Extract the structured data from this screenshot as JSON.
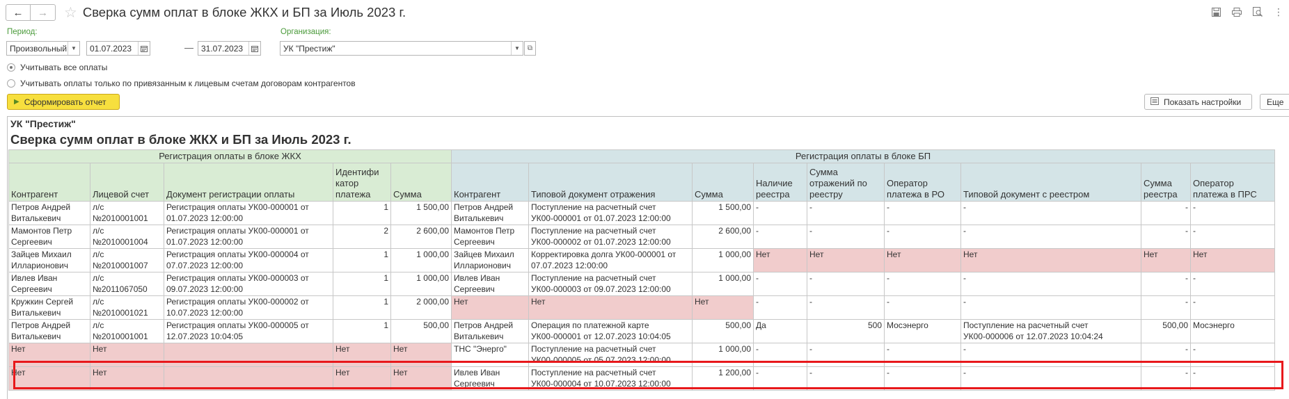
{
  "window": {
    "title": "Сверка сумм оплат в блоке ЖКХ и БП за Июль 2023 г.",
    "nav": {
      "back_icon": "arrow-left-icon",
      "forward_icon": "arrow-right-icon"
    },
    "toolbar_icons": [
      "save-icon",
      "print-icon",
      "preview-icon",
      "more-vertical-icon"
    ]
  },
  "form": {
    "period_label": "Период:",
    "period_type": "Произвольный",
    "date_from": "01.07.2023",
    "date_to": "31.07.2023",
    "period_separator": "—",
    "org_label": "Организация:",
    "org_value": "УК \"Престиж\"",
    "radio_all": "Учитывать все оплаты",
    "radio_linked": "Учитывать оплаты только по привязанным к лицевым счетам договорам контрагентов",
    "radio_selected": "all",
    "run_button": "Сформировать отчет",
    "settings_button": "Показать настройки",
    "more_button": "Еще"
  },
  "report": {
    "org": "УК \"Престиж\"",
    "title": "Сверка сумм оплат в блоке ЖКХ и БП за Июль 2023 г.",
    "group1": "Регистрация оплаты в блоке ЖКХ",
    "group2": "Регистрация оплаты в блоке БП",
    "colors": {
      "jkh_header": "#d9ecd4",
      "bp_header": "#d4e4e7",
      "mismatch": "#f1cccc",
      "highlight": "#e8181b"
    },
    "columns": [
      "Контрагент",
      "Лицевой счет",
      "Документ регистрации оплаты",
      "Идентифи\nкатор\nплатежа",
      "Сумма",
      "Контрагент",
      "Типовой документ отражения",
      "Сумма",
      "Наличие\nреестра",
      "Сумма\nотражений по\nреестру",
      "Оператор\nплатежа в РО",
      "Типовой документ с реестром",
      "Сумма\nреестра",
      "Оператор\nплатежа в ПРС"
    ],
    "rows": [
      {
        "cells": [
          "Петров Андрей\nВиталькевич",
          "л/с\n№2010001001",
          "Регистрация оплаты УК00-000001 от\n01.07.2023 12:00:00",
          "1",
          "1 500,00",
          "Петров Андрей\nВиталькевич",
          "Поступление на расчетный счет\nУК00-000001 от 01.07.2023 12:00:00",
          "1 500,00",
          "-",
          "-",
          "-",
          "-",
          "-",
          "-"
        ],
        "bad": []
      },
      {
        "cells": [
          "Мамонтов Петр\nСергеевич",
          "л/с\n№2010001004",
          "Регистрация оплаты УК00-000001 от\n01.07.2023 12:00:00",
          "2",
          "2 600,00",
          "Мамонтов Петр\nСергеевич",
          "Поступление на расчетный счет\nУК00-000002 от 01.07.2023 12:00:00",
          "2 600,00",
          "-",
          "-",
          "-",
          "-",
          "-",
          "-"
        ],
        "bad": []
      },
      {
        "cells": [
          "Зайцев Михаил\nИлларионович",
          "л/с\n№2010001007",
          "Регистрация оплаты УК00-000004 от\n07.07.2023 12:00:00",
          "1",
          "1 000,00",
          "Зайцев Михаил\nИлларионович",
          "Корректировка долга УК00-000001 от\n07.07.2023 12:00:00",
          "1 000,00",
          "Нет",
          "Нет",
          "Нет",
          "Нет",
          "Нет",
          "Нет"
        ],
        "bad": [
          8,
          9,
          10,
          11,
          12,
          13
        ]
      },
      {
        "cells": [
          "Ивлев Иван\nСергеевич",
          "л/с\n№2011067050",
          "Регистрация оплаты УК00-000003 от\n09.07.2023 12:00:00",
          "1",
          "1 000,00",
          "Ивлев Иван\nСергеевич",
          "Поступление на расчетный счет\nУК00-000003 от 09.07.2023 12:00:00",
          "1 000,00",
          "-",
          "-",
          "-",
          "-",
          "-",
          "-"
        ],
        "bad": []
      },
      {
        "cells": [
          "Кружкин Сергей\nВиталькевич",
          "л/с\n№2010001021",
          "Регистрация оплаты УК00-000002 от\n10.07.2023 12:00:00",
          "1",
          "2 000,00",
          "Нет",
          "Нет",
          "Нет",
          "-",
          "-",
          "-",
          "-",
          "-",
          "-"
        ],
        "bad": [
          5,
          6,
          7
        ]
      },
      {
        "cells": [
          "Петров Андрей\nВиталькевич",
          "л/с\n№2010001001",
          "Регистрация оплаты УК00-000005 от\n12.07.2023 10:04:05",
          "1",
          "500,00",
          "Петров Андрей\nВиталькевич",
          "Операция по платежной карте\nУК00-000001 от 12.07.2023 10:04:05",
          "500,00",
          "Да",
          "500",
          "Мосэнерго",
          "Поступление на расчетный счет\nУК00-000006 от 12.07.2023 10:04:24",
          "500,00",
          "Мосэнерго"
        ],
        "bad": []
      },
      {
        "cells": [
          "Нет",
          "Нет",
          "",
          "Нет",
          "Нет",
          "ТНС \"Энерго\"",
          "Поступление на расчетный счет\nУК00-000005 от 05.07.2023 12:00:00",
          "1 000,00",
          "-",
          "-",
          "-",
          "-",
          "-",
          "-"
        ],
        "bad": [
          0,
          1,
          2,
          3,
          4
        ]
      },
      {
        "cells": [
          "Нет",
          "Нет",
          "",
          "Нет",
          "Нет",
          "Ивлев Иван\nСергеевич",
          "Поступление на расчетный счет\nУК00-000004 от 10.07.2023 12:00:00",
          "1 200,00",
          "-",
          "-",
          "-",
          "-",
          "-",
          "-"
        ],
        "bad": [
          0,
          1,
          2,
          3,
          4
        ]
      }
    ]
  }
}
